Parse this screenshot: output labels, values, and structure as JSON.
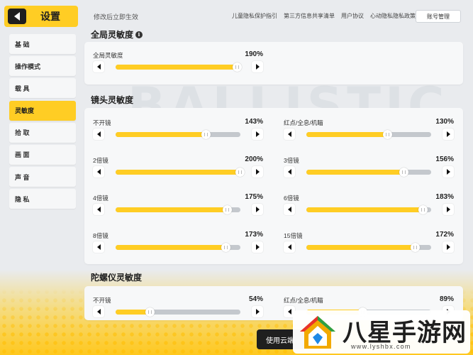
{
  "header": {
    "title": "设置",
    "notice": "修改后立即生效",
    "links": [
      "儿童隐私保护指引",
      "第三方信息共享清单",
      "用户协议",
      "心动隐私隐私政策"
    ],
    "account_button": "账号管理"
  },
  "sidebar": {
    "items": [
      {
        "label": "基 础",
        "active": false
      },
      {
        "label": "操作模式",
        "active": false
      },
      {
        "label": "载 具",
        "active": false
      },
      {
        "label": "灵敏度",
        "active": true
      },
      {
        "label": "拾 取",
        "active": false
      },
      {
        "label": "画 面",
        "active": false
      },
      {
        "label": "声 音",
        "active": false
      },
      {
        "label": "隐 私",
        "active": false
      }
    ]
  },
  "sections": {
    "global": {
      "title": "全局灵敏度",
      "sliders": [
        {
          "label": "全局灵敏度",
          "value": "190%",
          "fraction": 0.97
        }
      ]
    },
    "scope": {
      "title": "镜头灵敏度",
      "sliders": [
        {
          "label": "不开镜",
          "value": "143%",
          "fraction": 0.72
        },
        {
          "label": "红点/全息/机瞄",
          "value": "130%",
          "fraction": 0.65
        },
        {
          "label": "2倍镜",
          "value": "200%",
          "fraction": 0.995
        },
        {
          "label": "3倍镜",
          "value": "156%",
          "fraction": 0.78
        },
        {
          "label": "4倍镜",
          "value": "175%",
          "fraction": 0.89
        },
        {
          "label": "6倍镜",
          "value": "183%",
          "fraction": 0.93
        },
        {
          "label": "8倍镜",
          "value": "173%",
          "fraction": 0.88
        },
        {
          "label": "15倍镜",
          "value": "172%",
          "fraction": 0.87
        }
      ]
    },
    "gyro": {
      "title": "陀螺仪灵敏度",
      "sliders": [
        {
          "label": "不开镜",
          "value": "54%",
          "fraction": 0.27
        },
        {
          "label": "红点/全息/机瞄",
          "value": "89%",
          "fraction": 0.45
        }
      ]
    }
  },
  "footer": {
    "cloud_button": "使用云端"
  },
  "watermark": {
    "name": "八星手游网",
    "url": "www.lyshbx.com"
  },
  "colors": {
    "accent": "#ffcd24",
    "track": "#c4c8cd",
    "dark": "#1f1f1f"
  }
}
